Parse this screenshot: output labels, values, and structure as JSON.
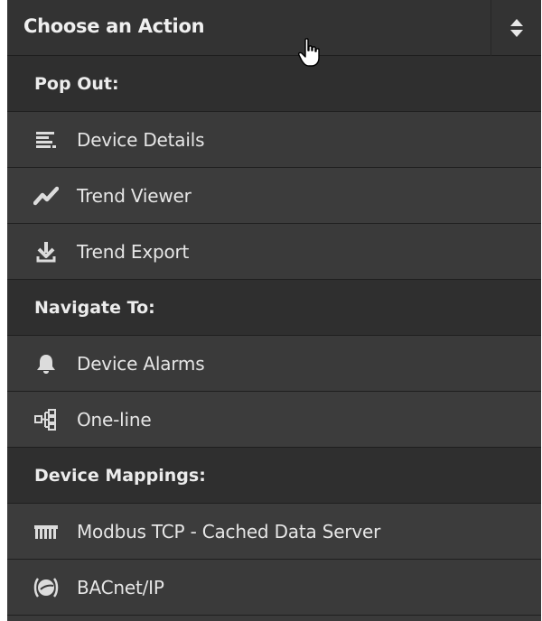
{
  "select": {
    "label": "Choose an Action",
    "toggle_icon": "sort-arrows-icon"
  },
  "sections": [
    {
      "header": "Pop Out:",
      "items": [
        {
          "label": "Device Details",
          "icon": "details-list-icon"
        },
        {
          "label": "Trend Viewer",
          "icon": "trend-line-icon"
        },
        {
          "label": "Trend Export",
          "icon": "download-arrow-icon"
        }
      ]
    },
    {
      "header": "Navigate To:",
      "items": [
        {
          "label": "Device Alarms",
          "icon": "bell-icon"
        },
        {
          "label": "One-line",
          "icon": "one-line-diagram-icon"
        }
      ]
    },
    {
      "header": "Device Mappings:",
      "items": [
        {
          "label": "Modbus TCP - Cached Data Server",
          "icon": "modbus-icon"
        },
        {
          "label": "BACnet/IP",
          "icon": "bacnet-icon"
        }
      ]
    }
  ],
  "colors": {
    "panel_bg": "#3a3a3a",
    "header_bg": "#2f2f2f",
    "text": "#e6e6e6"
  }
}
